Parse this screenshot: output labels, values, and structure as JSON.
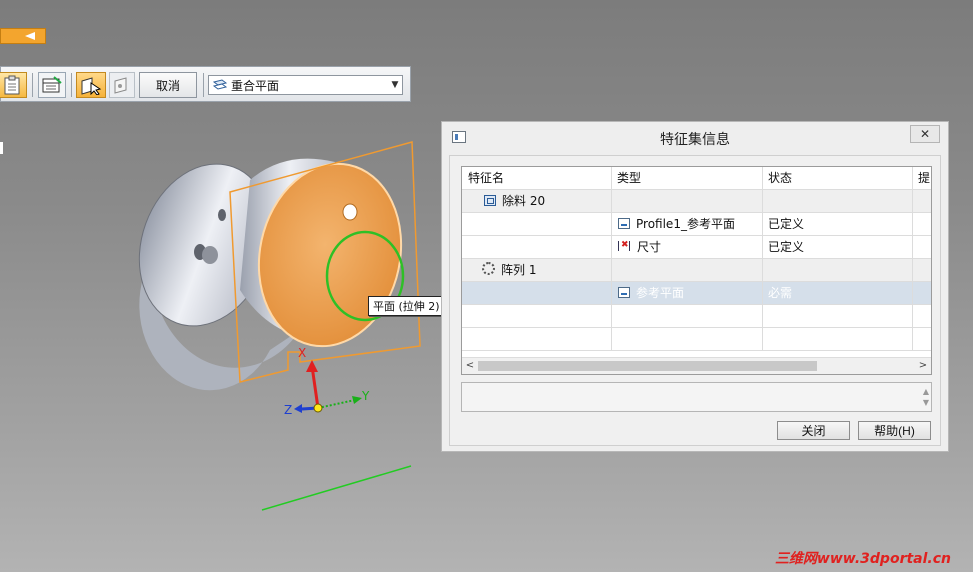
{
  "toolbar": {
    "cancel_label": "取消",
    "plane_select_value": "重合平面"
  },
  "viewport": {
    "tooltip": "平面 (拉伸 2)",
    "triad": {
      "x_label": "X",
      "y_label": "Y",
      "z_label": "Z"
    },
    "colors": {
      "highlight": "#f0a85a",
      "profile_circle": "#2ec026",
      "x_axis": "#e02020",
      "y_axis": "#18b018",
      "z_axis": "#1e3fd0"
    }
  },
  "dialog": {
    "title": "特征集信息",
    "close_glyph": "✕",
    "columns": [
      "特征名",
      "类型",
      "状态",
      "提"
    ],
    "rows": [
      {
        "name": "除料 20",
        "type": "",
        "status": "",
        "icon": "cutout-icon",
        "kind": "group"
      },
      {
        "name": "",
        "type": "Profile1_参考平面",
        "status": "已定义",
        "icon": "profile-icon",
        "kind": "child"
      },
      {
        "name": "",
        "type": "尺寸",
        "status": "已定义",
        "icon": "dimension-icon",
        "kind": "child"
      },
      {
        "name": "阵列 1",
        "type": "",
        "status": "",
        "icon": "pattern-icon",
        "kind": "group"
      },
      {
        "name": "",
        "type": "参考平面",
        "status": "必需",
        "icon": "profile-icon",
        "kind": "selected"
      }
    ],
    "close_button": "关闭",
    "help_button": "帮助(H)"
  },
  "watermark": "三维网www.3dportal.cn"
}
